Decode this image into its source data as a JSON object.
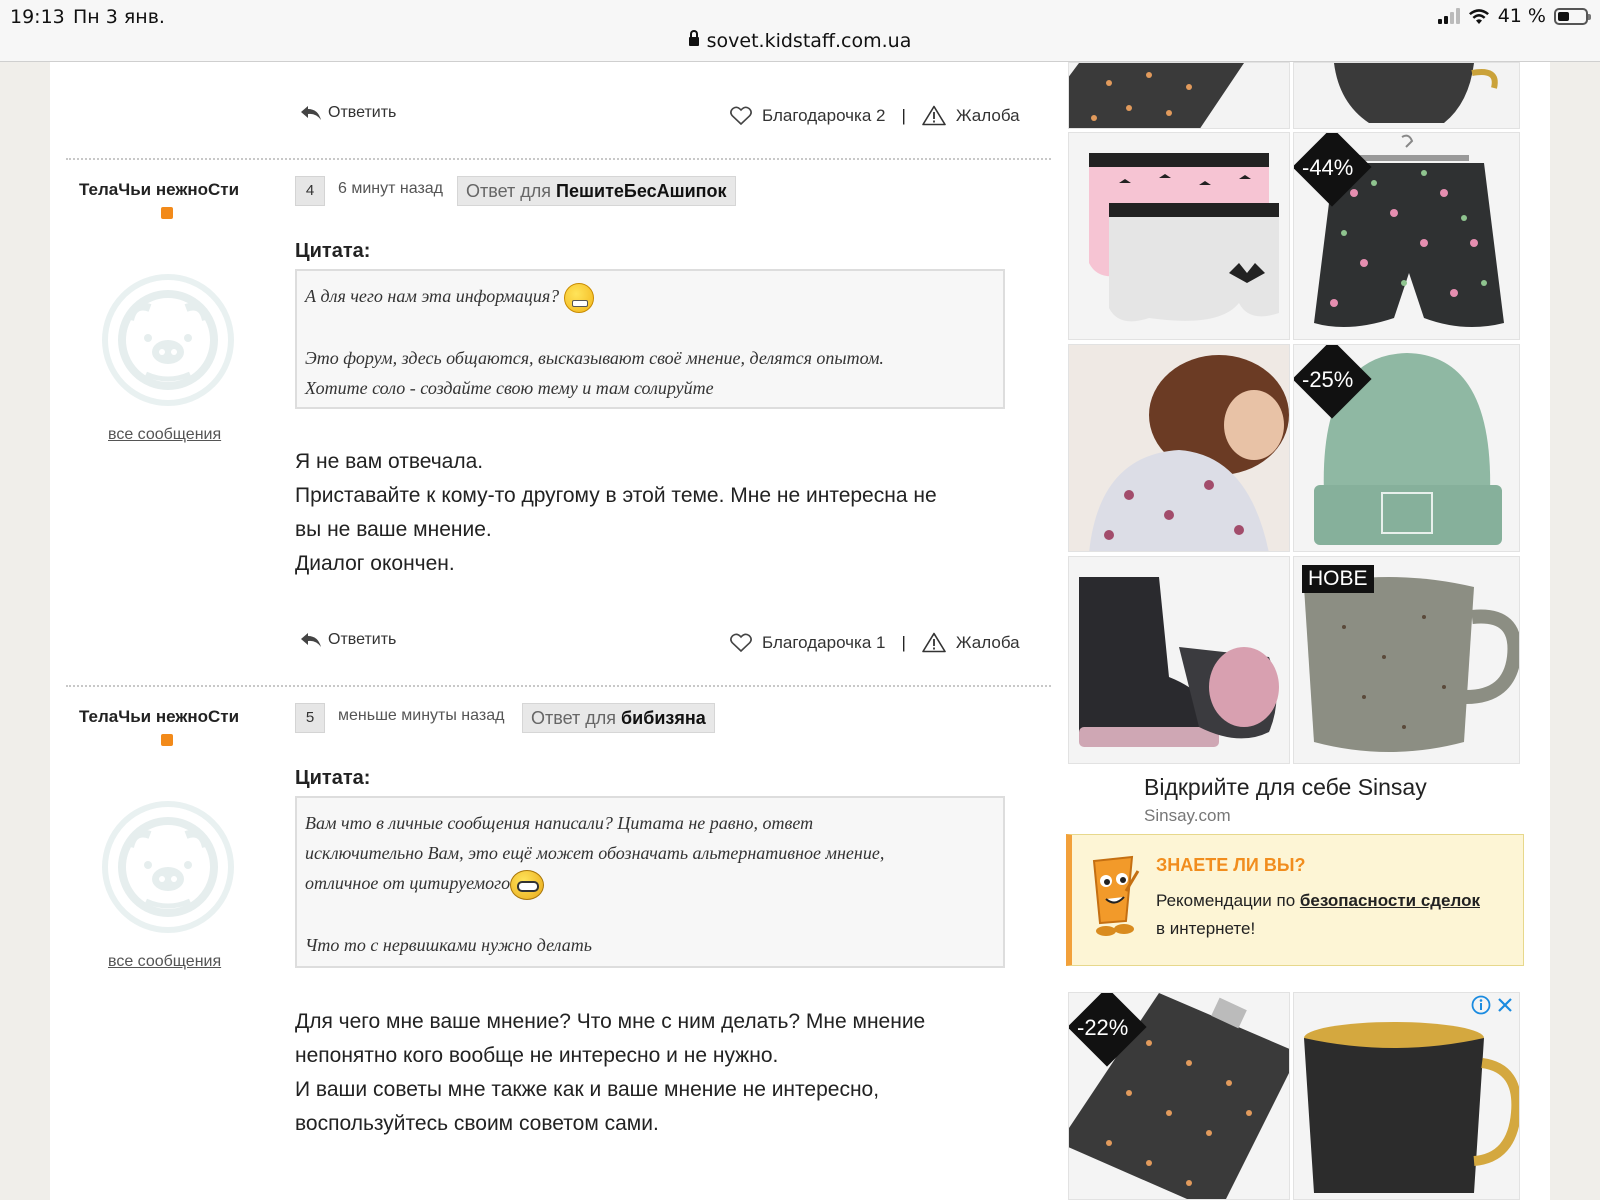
{
  "statusbar": {
    "time": "19:13",
    "date": "Пн 3 янв.",
    "battery": "41 %",
    "url": "sovet.kidstaff.com.ua"
  },
  "actions": {
    "reply": "Ответить",
    "thanks_prefix": "Благодарочка",
    "complaint": "Жалоба"
  },
  "top_post": {
    "thanks_count": "2"
  },
  "posts": [
    {
      "author": "ТелаЧьи нежноСти",
      "number": "4",
      "time_ago": "6 минут назад",
      "reply_to_prefix": "Ответ для",
      "reply_to_user": "ПешитеБесАшипок",
      "quote_label": "Цитата:",
      "quote_lines": [
        "А для чего нам эта информация?",
        "Это форум, здесь общаются, высказывают своё мнение, делятся опытом.",
        "Хотите соло - создайте свою тему и там солируйте"
      ],
      "text_lines": [
        "Я не вам отвечала.",
        "Приставайте к кому-то другому в этой теме. Мне не интересна не",
        "вы не ваше мнение.",
        "Диалог окончен."
      ],
      "all_messages": "все сообщения",
      "thanks_count": "1"
    },
    {
      "author": "ТелаЧьи нежноСти",
      "number": "5",
      "time_ago": "меньше минуты назад",
      "reply_to_prefix": "Ответ для",
      "reply_to_user": "бибизяна",
      "quote_label": "Цитата:",
      "quote_lines": [
        "Вам что в личные сообщения написали? Цитата не равно, ответ",
        "исключительно Вам, это ещё может обозначать альтернативное мнение,",
        "отличное от цитируемого",
        "Что то с нервишками нужно делать"
      ],
      "text_lines": [
        "Для чего мне ваше мнение? Что мне с ним делать? Мне мнение",
        "непонятно кого вообще не интересно и не нужно.",
        "И ваши советы мне также как и ваше мнение не интересно,",
        "воспользуйтесь своим советом сами."
      ],
      "all_messages": "все сообщения"
    }
  ],
  "ads": {
    "badges": [
      "-44%",
      "-25%",
      "НОВЕ",
      "-22%"
    ],
    "title": "Відкрийте для себе Sinsay",
    "domain": "Sinsay.com"
  },
  "know": {
    "title": "ЗНАЕТЕ ЛИ ВЫ?",
    "text_prefix": "Рекомендации по",
    "link": "безопасности сделок",
    "text_suffix": "в интернете!"
  },
  "colors": {
    "status_dot": "#f28a1a",
    "know_accent": "#f18d1e",
    "know_bg": "#fdf5d5"
  }
}
